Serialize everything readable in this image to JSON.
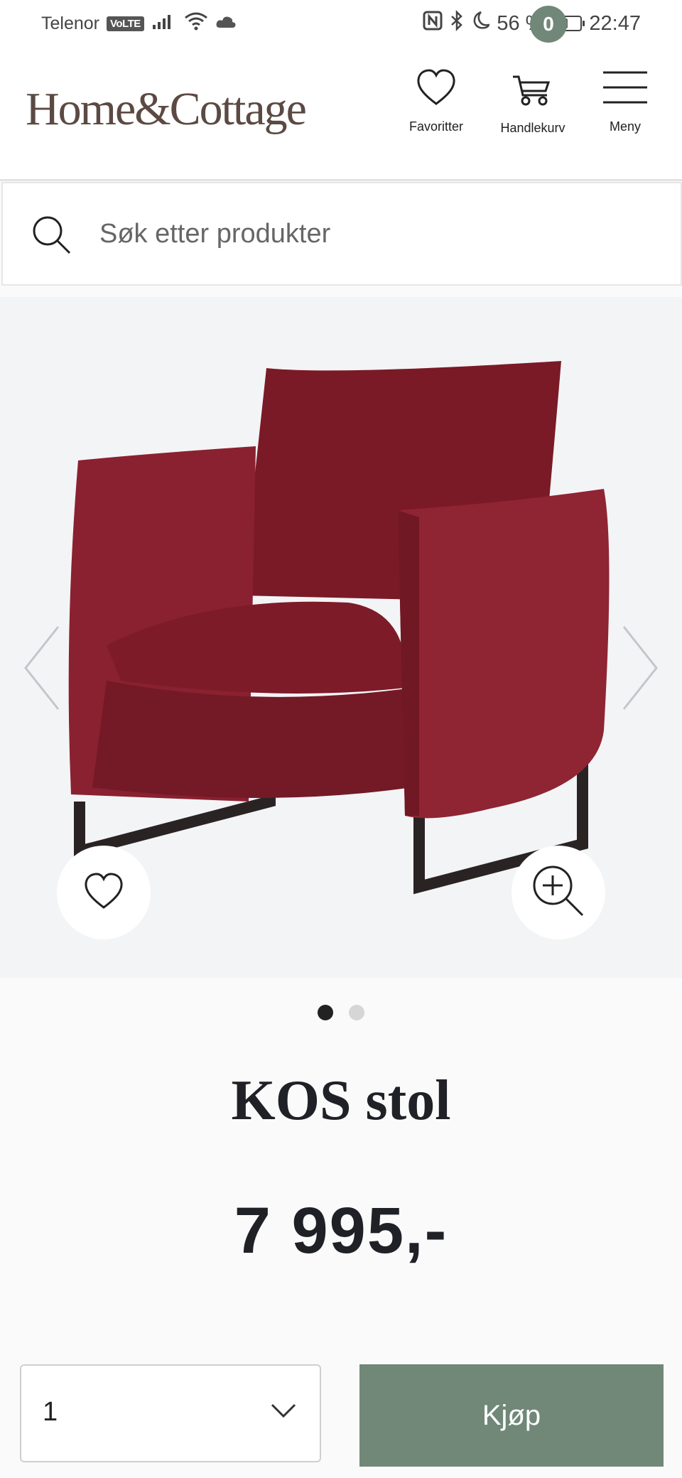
{
  "status_bar": {
    "carrier": "Telenor",
    "volte": "VoLTE",
    "battery_percent": "56 %",
    "battery_level": 0.56,
    "time": "22:47"
  },
  "header": {
    "logo": "Home&Cottage",
    "favorites_label": "Favoritter",
    "cart_label": "Handlekurv",
    "cart_count": "0",
    "menu_label": "Meny"
  },
  "search": {
    "placeholder": "Søk etter produkter"
  },
  "gallery": {
    "image_count": 2,
    "active_index": 0,
    "accent": "#7a1a26"
  },
  "product": {
    "title": "KOS stol",
    "price": "7 995,-"
  },
  "purchase": {
    "quantity": "1",
    "buy_label": "Kjøp"
  },
  "colors": {
    "brand_green": "#718879",
    "logo_brown": "#5b4a43"
  }
}
